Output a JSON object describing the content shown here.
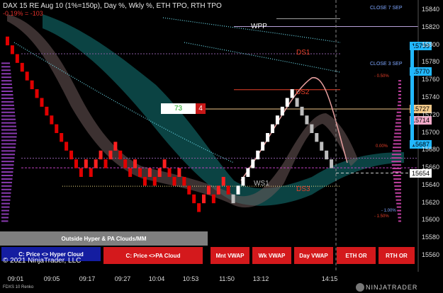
{
  "header": {
    "title": "DAX 15 RE Aug 10 (1%=150p), Day %, Wkly %, ETH TPO, RTH TPO",
    "subtitle": "-0.19% = -103"
  },
  "instrument_label": "FDXS 10 Renko",
  "copyright": "© 2021 NinjaTrader, LLC",
  "brand": "NINJATRADER",
  "levels": {
    "wpp": "WPP",
    "ds1": "DS1",
    "ds2": "DS2",
    "ds3": "DS3",
    "ws1": "WS1",
    "close7": "CLOSE 7 SEP",
    "close3": "CLOSE 3 SEP"
  },
  "pct_labels": {
    "neg050": "- 0.50%",
    "neg100": "- 1.00%",
    "neg150": "- 1.50%",
    "pos000": "0.00%"
  },
  "counter": {
    "left": "73",
    "right": "4"
  },
  "cloud_label": "Outside Hyper & PA Clouds/MM",
  "buttons": {
    "price_hyper": "C: Price <> Hyper Cloud",
    "price_pa": "C: Price <>PA Cloud",
    "mnt_vwap": "Mnt VWAP",
    "wk_vwap": "Wk VWAP",
    "day_vwap": "Day VWAP",
    "eth_or": "ETH OR",
    "rth_or": "RTH OR"
  },
  "price_tags": [
    {
      "label": "15799",
      "price": 15799,
      "color": "#22b8ff"
    },
    {
      "label": "15770",
      "price": 15770,
      "color": "#22b8ff"
    },
    {
      "label": "15727",
      "price": 15727,
      "color": "#f2c98a"
    },
    {
      "label": "15714",
      "price": 15714,
      "color": "#f1a9c8"
    },
    {
      "label": "15687",
      "price": 15687,
      "color": "#22b8ff"
    },
    {
      "label": "15654",
      "price": 15654,
      "color": "#ffffff"
    }
  ],
  "y_axis": {
    "ticks": [
      "15840",
      "15820",
      "15800",
      "15780",
      "15760",
      "15740",
      "15720",
      "15700",
      "15680",
      "15660",
      "15640",
      "15620",
      "15600",
      "15580",
      "15560"
    ]
  },
  "x_axis": {
    "ticks": [
      "09:01",
      "09:05",
      "09:17",
      "09:27",
      "10:04",
      "10:53",
      "11:50",
      "13:12",
      "14:15"
    ]
  },
  "chart_data": {
    "type": "candlestick",
    "ylim": [
      15548,
      15848
    ],
    "bricks": [
      {
        "price": 15800,
        "dir": "down"
      },
      {
        "price": 15790,
        "dir": "down"
      },
      {
        "price": 15780,
        "dir": "down"
      },
      {
        "price": 15770,
        "dir": "down"
      },
      {
        "price": 15760,
        "dir": "down"
      },
      {
        "price": 15750,
        "dir": "down"
      },
      {
        "price": 15740,
        "dir": "down"
      },
      {
        "price": 15730,
        "dir": "down"
      },
      {
        "price": 15720,
        "dir": "down"
      },
      {
        "price": 15710,
        "dir": "down"
      },
      {
        "price": 15700,
        "dir": "down"
      },
      {
        "price": 15690,
        "dir": "down"
      },
      {
        "price": 15680,
        "dir": "down"
      },
      {
        "price": 15670,
        "dir": "down"
      },
      {
        "price": 15660,
        "dir": "down"
      },
      {
        "price": 15650,
        "dir": "down"
      },
      {
        "price": 15660,
        "dir": "up"
      },
      {
        "price": 15650,
        "dir": "down"
      },
      {
        "price": 15660,
        "dir": "up"
      },
      {
        "price": 15670,
        "dir": "up"
      },
      {
        "price": 15660,
        "dir": "down"
      },
      {
        "price": 15670,
        "dir": "up"
      },
      {
        "price": 15680,
        "dir": "up"
      },
      {
        "price": 15670,
        "dir": "down"
      },
      {
        "price": 15660,
        "dir": "down"
      },
      {
        "price": 15650,
        "dir": "down"
      },
      {
        "price": 15660,
        "dir": "up"
      },
      {
        "price": 15650,
        "dir": "down"
      },
      {
        "price": 15640,
        "dir": "down"
      },
      {
        "price": 15650,
        "dir": "up"
      },
      {
        "price": 15640,
        "dir": "down"
      },
      {
        "price": 15650,
        "dir": "up"
      },
      {
        "price": 15660,
        "dir": "up"
      },
      {
        "price": 15650,
        "dir": "down"
      },
      {
        "price": 15640,
        "dir": "down"
      },
      {
        "price": 15650,
        "dir": "up"
      },
      {
        "price": 15640,
        "dir": "down"
      },
      {
        "price": 15630,
        "dir": "down"
      },
      {
        "price": 15620,
        "dir": "down"
      },
      {
        "price": 15610,
        "dir": "down"
      },
      {
        "price": 15620,
        "dir": "up"
      },
      {
        "price": 15630,
        "dir": "up"
      },
      {
        "price": 15620,
        "dir": "down"
      },
      {
        "price": 15630,
        "dir": "up"
      },
      {
        "price": 15640,
        "dir": "up"
      },
      {
        "price": 15630,
        "dir": "down"
      },
      {
        "price": 15620,
        "dir": "down"
      },
      {
        "price": 15630,
        "dir": "up"
      },
      {
        "price": 15640,
        "dir": "up"
      },
      {
        "price": 15650,
        "dir": "up"
      },
      {
        "price": 15660,
        "dir": "up"
      },
      {
        "price": 15670,
        "dir": "up"
      },
      {
        "price": 15680,
        "dir": "up"
      },
      {
        "price": 15690,
        "dir": "up"
      },
      {
        "price": 15700,
        "dir": "up"
      },
      {
        "price": 15710,
        "dir": "up"
      },
      {
        "price": 15720,
        "dir": "up"
      },
      {
        "price": 15730,
        "dir": "up"
      },
      {
        "price": 15740,
        "dir": "up"
      },
      {
        "price": 15730,
        "dir": "down"
      },
      {
        "price": 15720,
        "dir": "down"
      },
      {
        "price": 15710,
        "dir": "down"
      },
      {
        "price": 15700,
        "dir": "down"
      },
      {
        "price": 15690,
        "dir": "down"
      },
      {
        "price": 15680,
        "dir": "down"
      },
      {
        "price": 15670,
        "dir": "down"
      },
      {
        "price": 15660,
        "dir": "down"
      }
    ]
  }
}
